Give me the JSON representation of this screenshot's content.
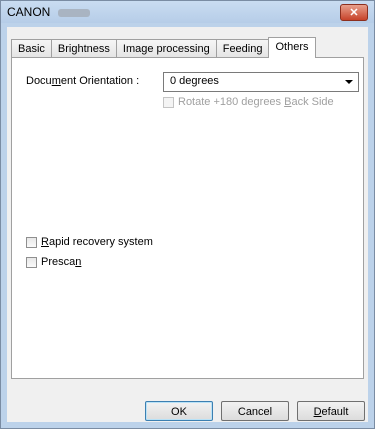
{
  "window": {
    "title": "CANON",
    "close_glyph": "✕"
  },
  "tabs": [
    {
      "label": "Basic",
      "active": false
    },
    {
      "label": "Brightness",
      "active": false
    },
    {
      "label": "Image processing",
      "active": false
    },
    {
      "label": "Feeding",
      "active": false
    },
    {
      "label": "Others",
      "active": true
    }
  ],
  "others": {
    "orientation_label": {
      "pre": "Docu",
      "mn": "m",
      "post": "ent Orientation :"
    },
    "orientation_value": "0 degrees",
    "rotate_back": {
      "pre": "Rotate +180 degrees ",
      "mn": "B",
      "post": "ack Side",
      "checked": false,
      "enabled": false
    },
    "rapid_recovery": {
      "pre": "",
      "mn": "R",
      "post": "apid recovery system",
      "checked": false
    },
    "prescan": {
      "pre": "Presca",
      "mn": "n",
      "post": "",
      "checked": false
    }
  },
  "buttons": {
    "ok": "OK",
    "cancel": "Cancel",
    "default": {
      "pre": "",
      "mn": "D",
      "post": "efault"
    }
  }
}
